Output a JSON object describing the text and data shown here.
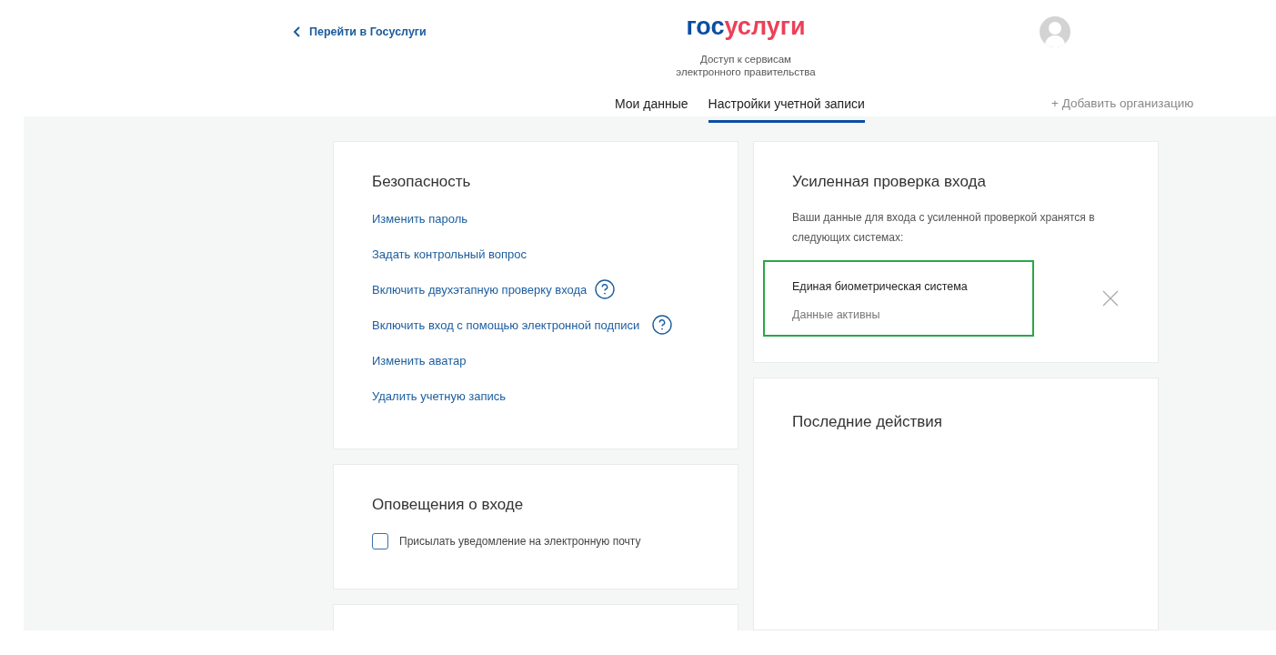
{
  "header": {
    "back_link": "Перейти в Госуслуги",
    "logo": {
      "part_1": "гос",
      "part_2": "услуги"
    },
    "tagline": [
      "Доступ к сервисам",
      "электронного правительства"
    ],
    "add_organization": "+ Добавить организацию"
  },
  "tabs": [
    {
      "label": "Мои данные",
      "selected": false
    },
    {
      "label": "Настройки учетной записи",
      "selected": true
    }
  ],
  "security": {
    "title": "Безопасность",
    "links": [
      {
        "label": "Изменить пароль",
        "help": false
      },
      {
        "label": "Задать контрольный вопрос",
        "help": false
      },
      {
        "label": "Включить двухэтапную проверку входа",
        "help": true
      },
      {
        "label": "Включить вход с помощью электронной подписи",
        "help": true
      },
      {
        "label": "Изменить аватар",
        "help": false
      },
      {
        "label": "Удалить учетную запись",
        "help": false
      }
    ]
  },
  "login_alerts": {
    "title": "Оповещения о входе",
    "options": [
      {
        "label": "Присылать уведомление на электронную почту",
        "checked": false
      }
    ]
  },
  "enhanced_check": {
    "title": "Усиленная проверка входа",
    "description": "Ваши данные для входа с усиленной проверкой хранятся в следующих системах:",
    "systems": [
      {
        "name": "Единая биометрическая система",
        "status": "Данные активны",
        "active": true
      }
    ]
  },
  "recent_actions": {
    "title": "Последние действия"
  }
}
